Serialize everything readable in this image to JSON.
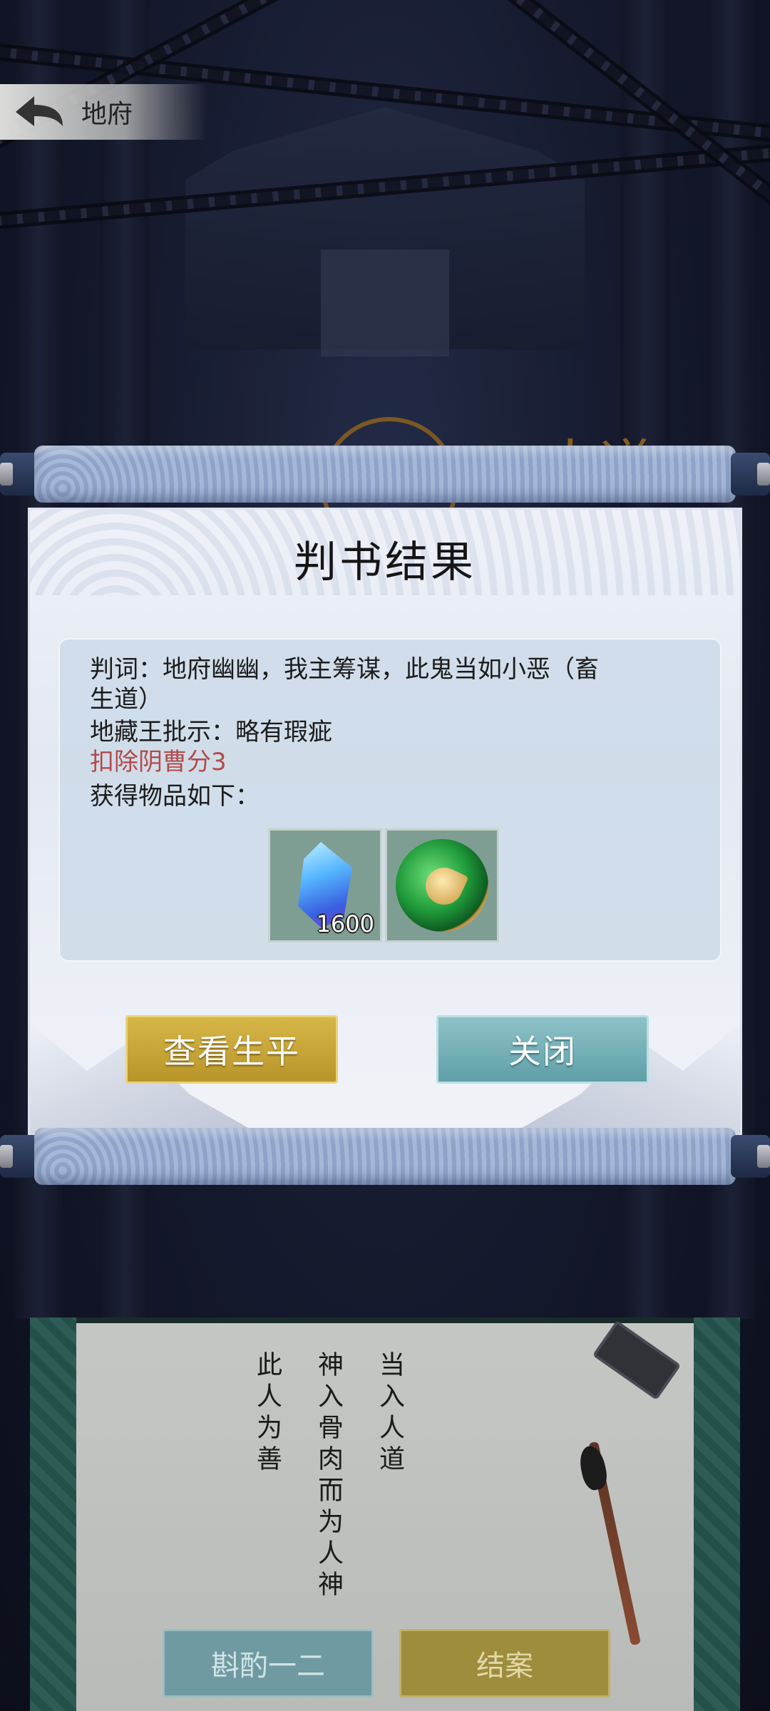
{
  "header": {
    "title": "地府",
    "back_icon": "back-arrow-icon"
  },
  "background": {
    "sign_text": "人道"
  },
  "dialog": {
    "title": "判书结果",
    "verdict": "判词：地府幽幽，我主筹谋，此鬼当如小恶（畜",
    "verdict_cont": "生道）",
    "approval": "地藏王批示：略有瑕疵",
    "penalty": "扣除阴曹分3",
    "rewards_label": "获得物品如下：",
    "items": [
      {
        "icon": "blue-crystal-icon",
        "count": "1600"
      },
      {
        "icon": "jade-fish-medallion-icon",
        "count": ""
      }
    ],
    "buttons": {
      "view_life": "查看生平",
      "close": "关闭"
    },
    "accent_colors": {
      "penalty_red": "#b34a4a",
      "gold_button": "#c9a73a",
      "teal_button": "#77b0b8"
    }
  },
  "ledger": {
    "columns": [
      "当入人道",
      "神入骨肉而为人神",
      "此人为善"
    ],
    "buttons": {
      "deliberate": "斟酌一二",
      "close_case": "结案"
    }
  }
}
